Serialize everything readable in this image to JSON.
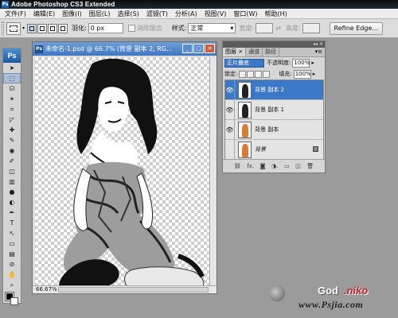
{
  "app": {
    "title": "Adobe Photoshop CS3 Extended",
    "badge": "Ps"
  },
  "menu": [
    "文件(F)",
    "编辑(E)",
    "图像(I)",
    "图层(L)",
    "选择(S)",
    "滤镜(T)",
    "分析(A)",
    "视图(V)",
    "窗口(W)",
    "帮助(H)"
  ],
  "options_bar": {
    "feather_label": "羽化:",
    "feather_value": "0 px",
    "antialias_label": "消除锯齿",
    "style_label": "样式:",
    "style_value": "正常",
    "width_label": "宽度:",
    "height_label": "高度:",
    "refine_edge": "Refine Edge..."
  },
  "toolbox": {
    "logo": "Ps",
    "tools": [
      "move-tool",
      "rect-marquee-tool",
      "lasso-tool",
      "magic-wand-tool",
      "crop-tool",
      "slice-tool",
      "healing-brush-tool",
      "brush-tool",
      "clone-stamp-tool",
      "history-brush-tool",
      "eraser-tool",
      "gradient-tool",
      "blur-tool",
      "dodge-tool",
      "pen-tool",
      "type-tool",
      "path-select-tool",
      "rect-shape-tool",
      "notes-tool",
      "eyedropper-tool",
      "hand-tool",
      "zoom-tool"
    ],
    "tool_glyphs": [
      "➤",
      "⬚",
      "ᘏ",
      "✶",
      "⌗",
      "◸",
      "✚",
      "✎",
      "◉",
      "✐",
      "◫",
      "▥",
      "●",
      "◐",
      "✒",
      "T",
      "↖",
      "▭",
      "▤",
      "⊘",
      "✋",
      "⌕"
    ],
    "selected_tool": "rect-marquee-tool",
    "foreground_color": "#000000",
    "background_color": "#ffffff"
  },
  "document": {
    "title": "未命名-1.psd @ 66.7% (背景 副本 2, RG...",
    "zoom": "66.67%",
    "icon": "Ps"
  },
  "layers_panel": {
    "tabs": [
      "图层 ×",
      "通道",
      "路径"
    ],
    "active_tab": "图层 ×",
    "blend_mode": "正片叠底",
    "opacity_label": "不透明度:",
    "opacity_value": "100%",
    "lock_label": "锁定:",
    "fill_label": "填充:",
    "fill_value": "100%",
    "layers": [
      {
        "name": "背景 副本 2",
        "visible": true,
        "selected": true,
        "thumb": "bw"
      },
      {
        "name": "背景 副本 1",
        "visible": true,
        "selected": false,
        "thumb": "bw"
      },
      {
        "name": "背景 副本",
        "visible": true,
        "selected": false,
        "thumb": "or"
      },
      {
        "name": "背景",
        "visible": false,
        "selected": false,
        "thumb": "or",
        "locked": true
      }
    ],
    "footer_icons": [
      "link-icon",
      "fx-icon",
      "mask-icon",
      "adjustment-icon",
      "group-icon",
      "new-layer-icon",
      "trash-icon"
    ],
    "footer_glyphs": [
      "⛓",
      "fx.",
      "◙",
      "◑.",
      "▭",
      "◫",
      "🗑"
    ]
  },
  "watermark": {
    "logo_text_a": "God",
    "logo_text_b": ".niko",
    "url": "www.Psjia.com"
  }
}
